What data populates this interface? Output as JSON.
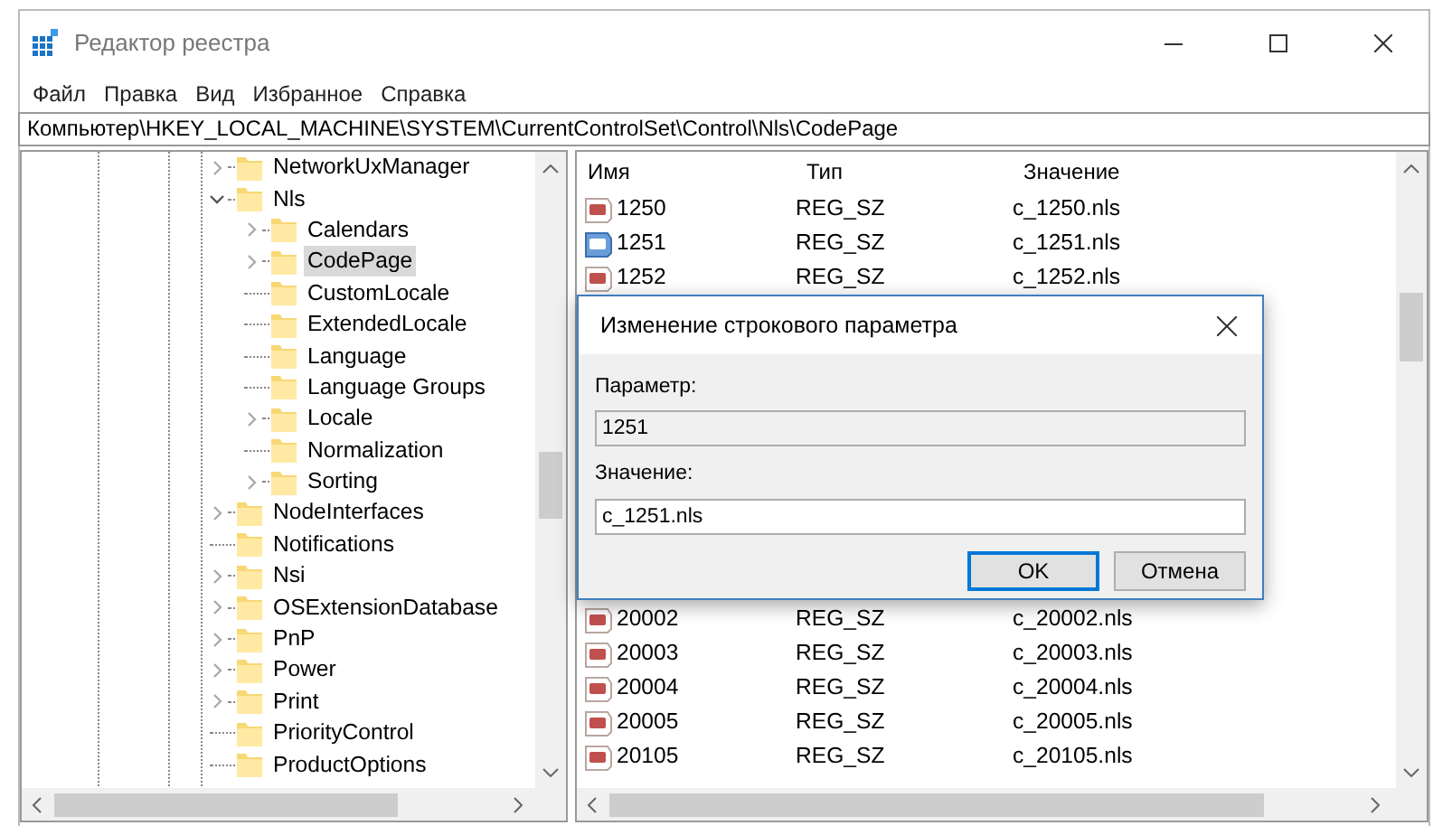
{
  "window": {
    "title": "Редактор реестра"
  },
  "menu": [
    "Файл",
    "Правка",
    "Вид",
    "Избранное",
    "Справка"
  ],
  "address": "Компьютер\\HKEY_LOCAL_MACHINE\\SYSTEM\\CurrentControlSet\\Control\\Nls\\CodePage",
  "tree": [
    {
      "label": "NetworkUxManager",
      "kind": "branch",
      "expanded": false,
      "selected": false
    },
    {
      "label": "Nls",
      "kind": "branch",
      "expanded": true,
      "selected": false,
      "children": [
        {
          "label": "Calendars",
          "kind": "branch",
          "expanded": false,
          "selected": false
        },
        {
          "label": "CodePage",
          "kind": "branch",
          "expanded": false,
          "selected": true
        },
        {
          "label": "CustomLocale",
          "kind": "leaf",
          "selected": false
        },
        {
          "label": "ExtendedLocale",
          "kind": "leaf",
          "selected": false
        },
        {
          "label": "Language",
          "kind": "leaf",
          "selected": false
        },
        {
          "label": "Language Groups",
          "kind": "leaf",
          "selected": false
        },
        {
          "label": "Locale",
          "kind": "branch",
          "expanded": false,
          "selected": false
        },
        {
          "label": "Normalization",
          "kind": "leaf",
          "selected": false
        },
        {
          "label": "Sorting",
          "kind": "branch",
          "expanded": false,
          "selected": false
        }
      ]
    },
    {
      "label": "NodeInterfaces",
      "kind": "branch",
      "expanded": false,
      "selected": false
    },
    {
      "label": "Notifications",
      "kind": "leaf",
      "selected": false
    },
    {
      "label": "Nsi",
      "kind": "branch",
      "expanded": false,
      "selected": false
    },
    {
      "label": "OSExtensionDatabase",
      "kind": "branch",
      "expanded": false,
      "selected": false
    },
    {
      "label": "PnP",
      "kind": "branch",
      "expanded": false,
      "selected": false
    },
    {
      "label": "Power",
      "kind": "branch",
      "expanded": false,
      "selected": false
    },
    {
      "label": "Print",
      "kind": "branch",
      "expanded": false,
      "selected": false
    },
    {
      "label": "PriorityControl",
      "kind": "leaf",
      "selected": false
    },
    {
      "label": "ProductOptions",
      "kind": "leaf",
      "selected": false
    }
  ],
  "values": {
    "columns": [
      "Имя",
      "Тип",
      "Значение"
    ],
    "rows_above_dialog": [
      {
        "name": "1250",
        "type": "REG_SZ",
        "data": "c_1250.nls",
        "selected": false
      },
      {
        "name": "1251",
        "type": "REG_SZ",
        "data": "c_1251.nls",
        "selected": true
      },
      {
        "name": "1252",
        "type": "REG_SZ",
        "data": "c_1252.nls",
        "selected": false
      }
    ],
    "rows_below_dialog": [
      {
        "name": "20002",
        "type": "REG_SZ",
        "data": "c_20002.nls",
        "selected": false
      },
      {
        "name": "20003",
        "type": "REG_SZ",
        "data": "c_20003.nls",
        "selected": false
      },
      {
        "name": "20004",
        "type": "REG_SZ",
        "data": "c_20004.nls",
        "selected": false
      },
      {
        "name": "20005",
        "type": "REG_SZ",
        "data": "c_20005.nls",
        "selected": false
      },
      {
        "name": "20105",
        "type": "REG_SZ",
        "data": "c_20105.nls",
        "selected": false
      }
    ]
  },
  "dialog": {
    "title": "Изменение строкового параметра",
    "param_label": "Параметр:",
    "param_value": "1251",
    "value_label": "Значение:",
    "value": "c_1251.nls",
    "buttons": [
      {
        "label": "OK",
        "default": true
      },
      {
        "label": "Отмена",
        "default": false
      }
    ]
  }
}
